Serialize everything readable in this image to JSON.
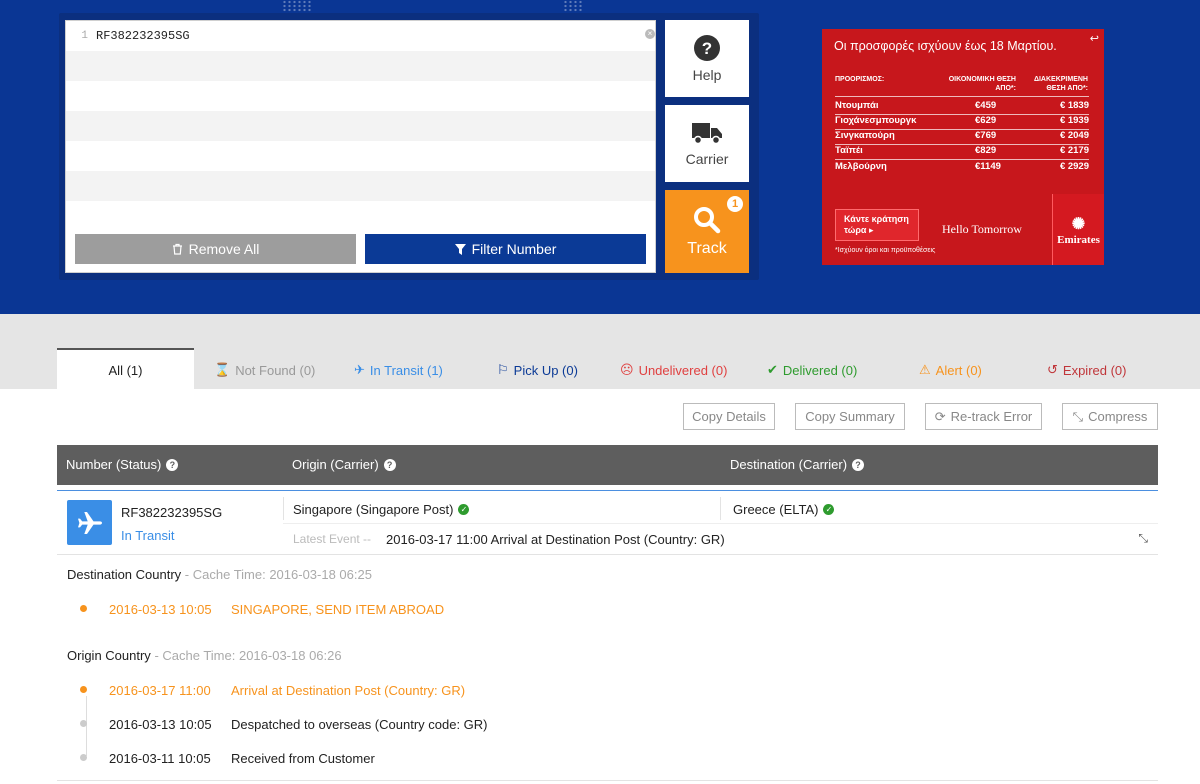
{
  "editor": {
    "lines": [
      {
        "no": "1",
        "text": "RF382232395SG"
      }
    ]
  },
  "buttons": {
    "remove_all": "Remove All",
    "filter_number": "Filter Number",
    "help": "Help",
    "carrier": "Carrier",
    "track": "Track",
    "track_badge": "1"
  },
  "ad": {
    "title": "Οι προσφορές ισχύουν έως 18 Μαρτίου.",
    "col_destination": "ΠΡΟΟΡΙΣΜΟΣ:",
    "col_economy": "ΟΙΚΟΝΟΜΙΚΗ ΘΕΣΗ ΑΠΟ*:",
    "col_business": "ΔΙΑΚΕΚΡΙΜΕΝΗ ΘΕΣΗ ΑΠΟ*:",
    "rows": [
      {
        "city": "Ντουμπάι",
        "economy": "€459",
        "business": "€ 1839"
      },
      {
        "city": "Γιοχάνεσμπουργκ",
        "economy": "€629",
        "business": "€ 1939"
      },
      {
        "city": "Σινγκαπούρη",
        "economy": "€769",
        "business": "€ 2049"
      },
      {
        "city": "Ταϊπέι",
        "economy": "€829",
        "business": "€ 2179"
      },
      {
        "city": "Μελβούρνη",
        "economy": "€1149",
        "business": "€ 2929"
      }
    ],
    "cta": "Κάντε κράτηση τώρα",
    "note": "*Ισχύουν όροι και προϋποθέσεις",
    "slogan": "Hello Tomorrow",
    "brand": "Emirates",
    "color": "#c7171c"
  },
  "tabs": {
    "all": "All (1)",
    "not_found": "Not Found (0)",
    "in_transit": "In Transit (1)",
    "pick_up": "Pick Up (0)",
    "undelivered": "Undelivered (0)",
    "delivered": "Delivered (0)",
    "alert": "Alert (0)",
    "expired": "Expired (0)"
  },
  "toolbar": {
    "copy_details": "Copy Details",
    "copy_summary": "Copy Summary",
    "retrack_error": "Re-track Error",
    "compress": "Compress"
  },
  "table": {
    "col_number": "Number (Status)",
    "col_origin": "Origin (Carrier)",
    "col_destination": "Destination (Carrier)"
  },
  "result": {
    "number": "RF382232395SG",
    "status": "In Transit",
    "origin": "Singapore (Singapore Post)",
    "destination": "Greece (ELTA)",
    "latest_label": "Latest Event --",
    "latest_event": "2016-03-17 11:00 Arrival at Destination Post (Country: GR)"
  },
  "destination_country": {
    "title": "Destination Country",
    "cache": "- Cache Time: 2016-03-18 06:25",
    "events": [
      {
        "date": "2016-03-13 10:05",
        "text": "SINGAPORE, SEND ITEM ABROAD"
      }
    ]
  },
  "origin_country": {
    "title": "Origin Country",
    "cache": "- Cache Time: 2016-03-18 06:26",
    "events": [
      {
        "date": "2016-03-17 11:00",
        "text": "Arrival at Destination Post (Country: GR)"
      },
      {
        "date": "2016-03-13 10:05",
        "text": "Despatched to overseas (Country code: GR)"
      },
      {
        "date": "2016-03-11 10:05",
        "text": "Received from Customer"
      }
    ]
  },
  "colors": {
    "brand_blue": "#0a3694",
    "accent_orange": "#f7931d",
    "transit_blue": "#3a8ee6",
    "success_green": "#2e9b2e"
  }
}
